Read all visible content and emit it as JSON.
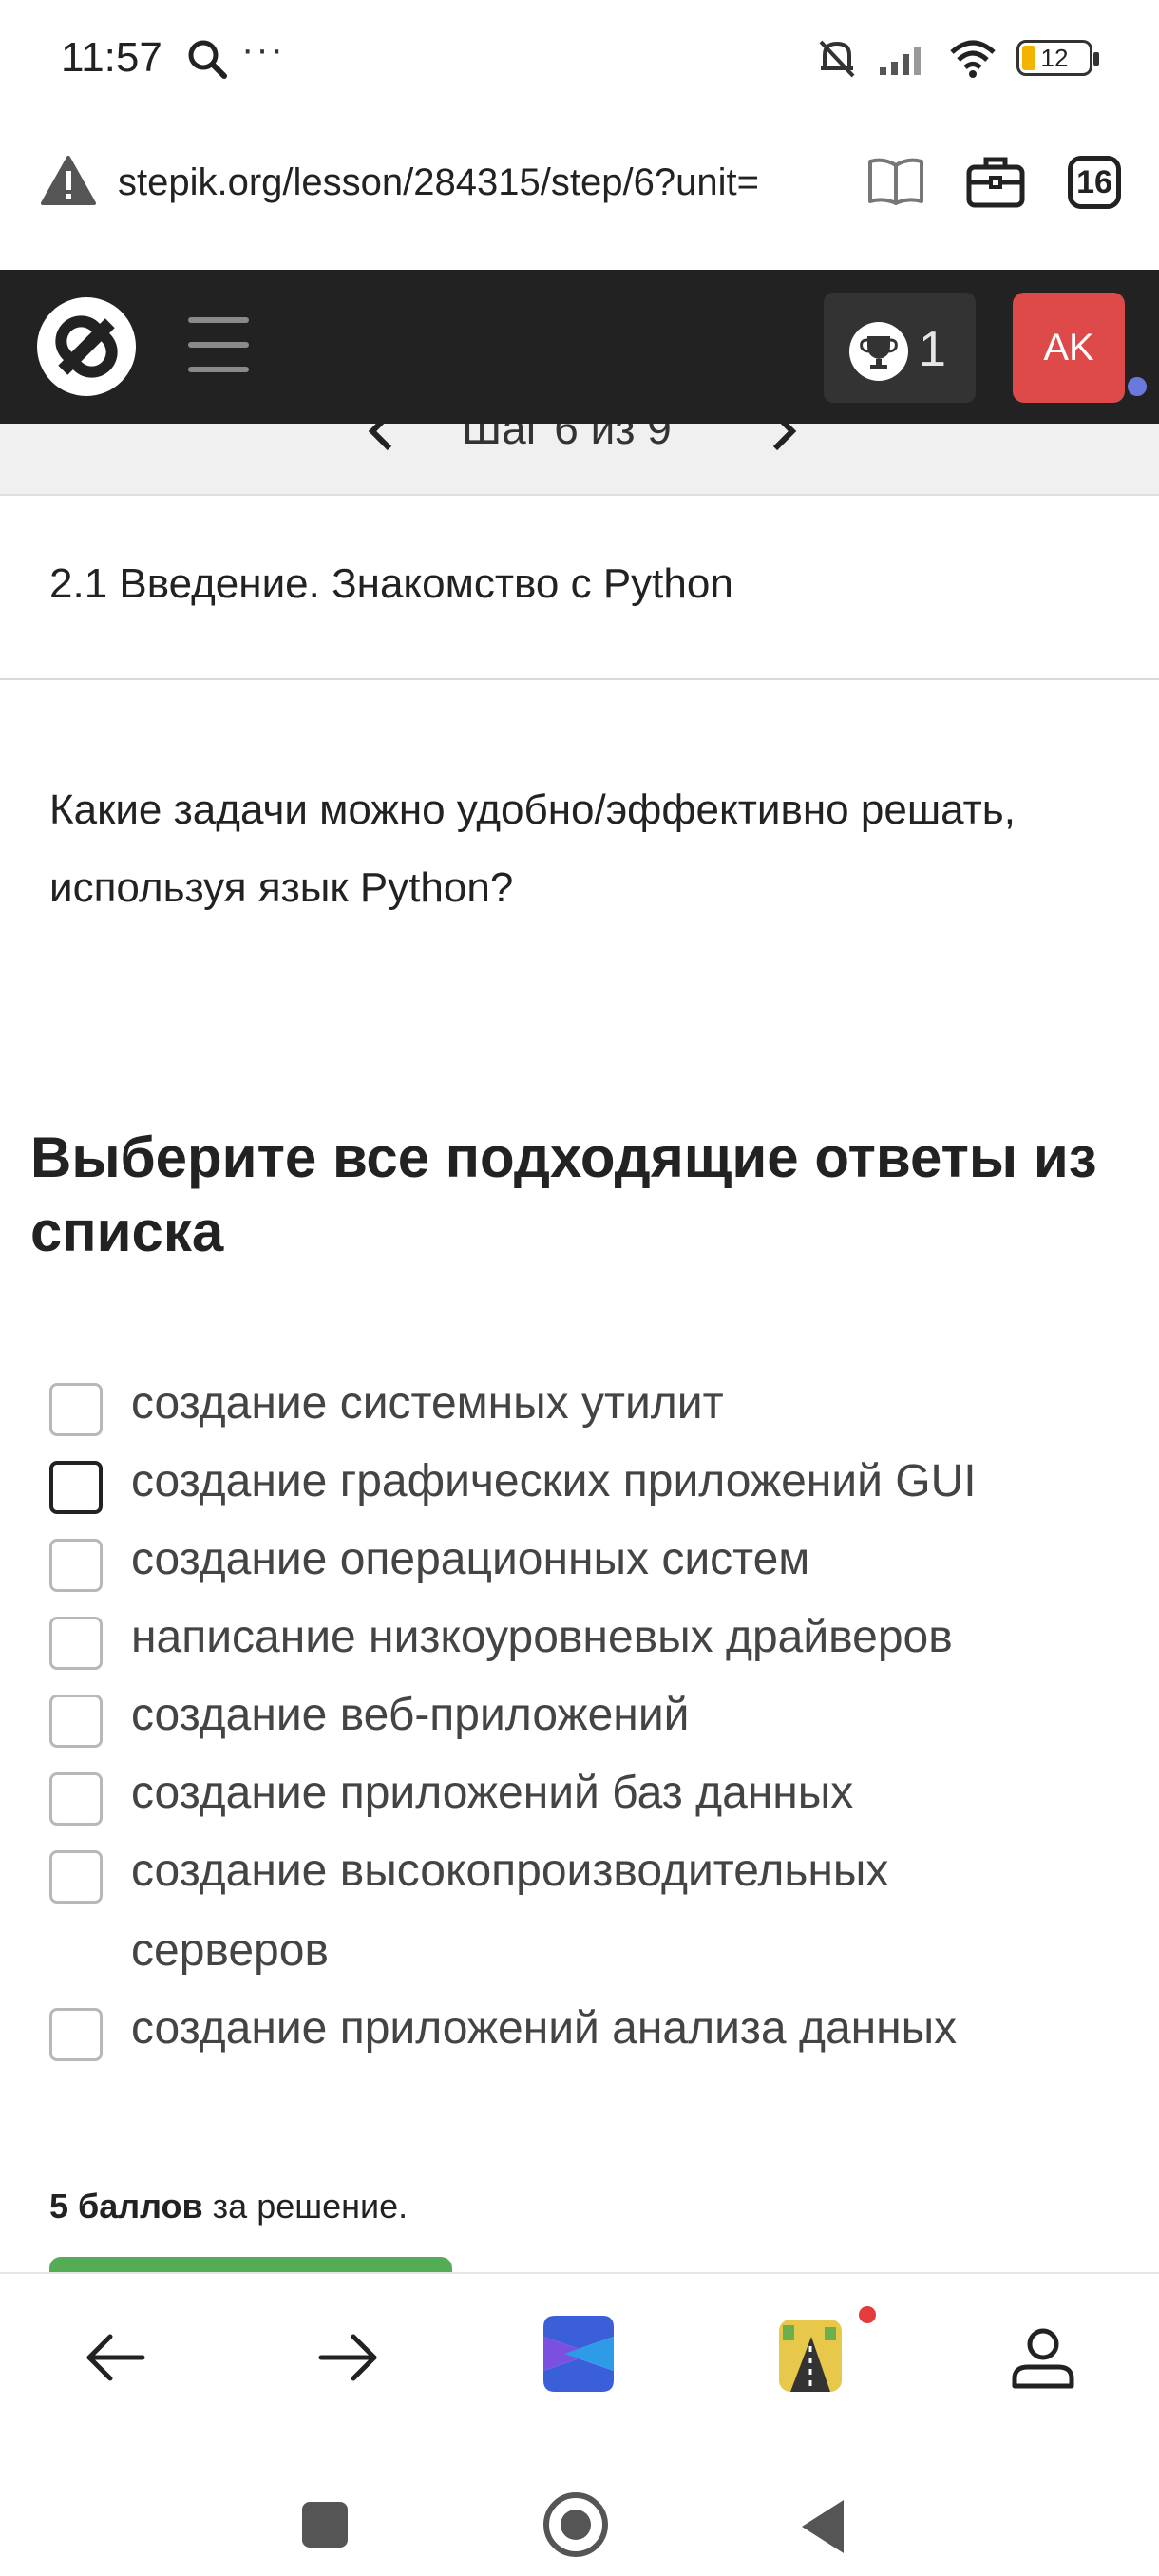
{
  "status_bar": {
    "time": "11:57",
    "more": "···",
    "battery": "12"
  },
  "browser": {
    "url": "stepik.org/lesson/284315/step/6?unit=",
    "tabs_count": "16"
  },
  "navbar": {
    "score": "1",
    "avatar_initials": "AK"
  },
  "step_nav": {
    "label": "Шаг 6 из 9"
  },
  "lesson": {
    "title": "2.1 Введение. Знакомство с Python"
  },
  "question": {
    "text": "Какие задачи можно удобно/эффективно решать, используя язык Python?"
  },
  "quiz": {
    "heading": "Выберите все подходящие ответы из списка",
    "options": [
      {
        "label": "создание системных утилит",
        "checked": false
      },
      {
        "label": "создание графических приложений GUI",
        "checked": false
      },
      {
        "label": "создание операционных систем",
        "checked": false
      },
      {
        "label": "написание низкоуровневых драйверов",
        "checked": false
      },
      {
        "label": "создание веб-приложений",
        "checked": false
      },
      {
        "label": "создание приложений баз данных",
        "checked": false
      },
      {
        "label": "создание высокопроизводительных серверов",
        "checked": false
      },
      {
        "label": "создание приложений анализа данных",
        "checked": false
      }
    ],
    "points_bold": "5 баллов",
    "points_rest": " за решение."
  },
  "colors": {
    "navbar_bg": "#222222",
    "avatar_bg": "#de4a4a",
    "submit_green": "#54ad54",
    "notification_dot": "#6c79dc"
  },
  "icons": {
    "status": [
      "search-icon",
      "mute-icon",
      "signal-icon",
      "wifi-icon",
      "battery-icon"
    ],
    "browser": [
      "warning-icon",
      "reader-mode-icon",
      "briefcase-icon",
      "tabs-icon"
    ],
    "bottom": [
      "back-arrow-icon",
      "forward-arrow-icon",
      "browser-app-icon",
      "game-app-icon",
      "profile-icon"
    ]
  }
}
